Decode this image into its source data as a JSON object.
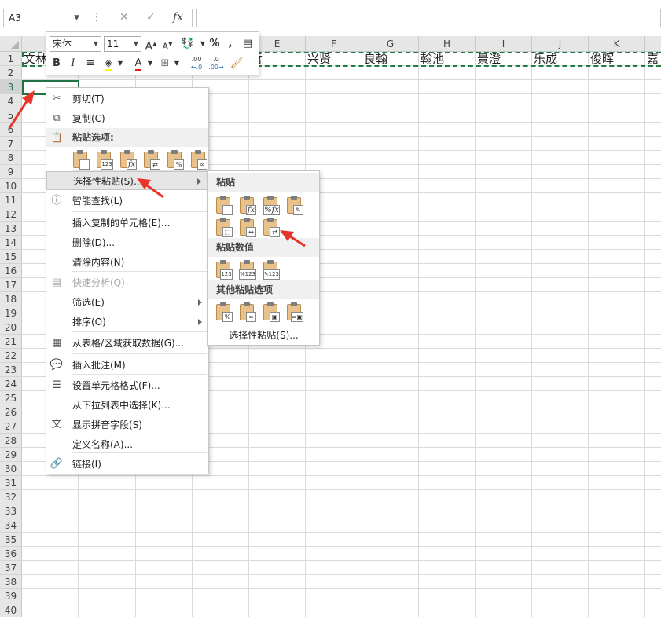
{
  "namebox": {
    "value": "A3"
  },
  "formula_bar": {
    "cancel_icon": "✕",
    "enter_icon": "✓",
    "fx_label": "fx",
    "content": ""
  },
  "columns": [
    "E",
    "F",
    "G",
    "H",
    "I",
    "J",
    "K"
  ],
  "rows": [
    "1",
    "2",
    "3",
    "4",
    "5",
    "6",
    "7",
    "8",
    "9",
    "10",
    "11",
    "12",
    "13",
    "14",
    "15",
    "16",
    "17",
    "18",
    "19",
    "20",
    "21",
    "22",
    "23",
    "24",
    "25",
    "26",
    "27",
    "28",
    "29",
    "30",
    "31",
    "32",
    "33",
    "34",
    "35",
    "36",
    "37",
    "38",
    "39",
    "40"
  ],
  "row1_cells": {
    "A": "文林",
    "E": "哲",
    "F": "兴贤",
    "G": "良翰",
    "H": "翰池",
    "I": "景澄",
    "J": "乐成",
    "K": "俊晖",
    "L": "嘉"
  },
  "mini_toolbar": {
    "font": "宋体",
    "size": "11",
    "grow_font": "A",
    "shrink_font": "A",
    "percent": "%",
    "comma": ",",
    "bold": "B",
    "italic": "I",
    "font_color_letter": "A",
    "increase_decimal": ".00",
    "decrease_decimal": ".0"
  },
  "context_menu": {
    "items": [
      {
        "label": "剪切(T)",
        "icon": "scissors-icon",
        "glyph": "✂"
      },
      {
        "label": "复制(C)",
        "icon": "copy-icon",
        "glyph": "⧉"
      },
      {
        "label": "粘贴选项:",
        "icon": "clipboard-icon",
        "glyph": "📋"
      },
      {
        "label": "选择性粘贴(S)...",
        "icon": "",
        "glyph": ""
      },
      {
        "label": "智能查找(L)",
        "icon": "smart-lookup-icon",
        "glyph": "ⓘ"
      },
      {
        "label": "插入复制的单元格(E)...",
        "icon": "",
        "glyph": ""
      },
      {
        "label": "删除(D)...",
        "icon": "",
        "glyph": ""
      },
      {
        "label": "清除内容(N)",
        "icon": "",
        "glyph": ""
      },
      {
        "label": "快速分析(Q)",
        "icon": "quick-analysis-icon",
        "glyph": "▤"
      },
      {
        "label": "筛选(E)",
        "icon": "",
        "glyph": ""
      },
      {
        "label": "排序(O)",
        "icon": "",
        "glyph": ""
      },
      {
        "label": "从表格/区域获取数据(G)...",
        "icon": "table-icon",
        "glyph": "▦"
      },
      {
        "label": "插入批注(M)",
        "icon": "comment-icon",
        "glyph": "💬"
      },
      {
        "label": "设置单元格格式(F)...",
        "icon": "format-cells-icon",
        "glyph": "☰"
      },
      {
        "label": "从下拉列表中选择(K)...",
        "icon": "",
        "glyph": ""
      },
      {
        "label": "显示拼音字段(S)",
        "icon": "phonetic-icon",
        "glyph": "文"
      },
      {
        "label": "定义名称(A)...",
        "icon": "",
        "glyph": ""
      },
      {
        "label": "链接(I)",
        "icon": "link-icon",
        "glyph": "🔗"
      }
    ],
    "paste_badges": [
      "",
      "123",
      "fx",
      "⇄",
      "%",
      "∞"
    ]
  },
  "submenu": {
    "paste_header": "粘贴",
    "paste_badges_row1": [
      "",
      "fx",
      "%fx",
      "✎"
    ],
    "paste_badges_row2": [
      "⬚",
      "↔",
      "⇄"
    ],
    "values_header": "粘贴数值",
    "values_badges": [
      "123",
      "%123",
      "✎123"
    ],
    "other_header": "其他粘贴选项",
    "other_badges": [
      "%",
      "∞",
      "▣",
      "∞▣"
    ],
    "special_label": "选择性粘贴(S)..."
  },
  "colors": {
    "accent_green": "#217346",
    "arrow_red": "#e8352a"
  }
}
